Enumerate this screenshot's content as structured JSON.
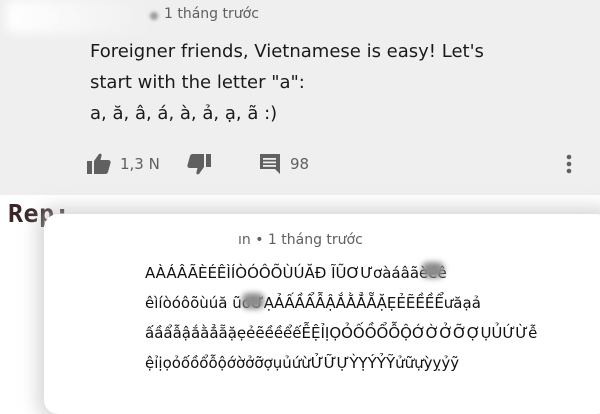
{
  "top_comment": {
    "timestamp": "1 tháng trước",
    "lines": [
      "Foreigner friends, Vietnamese is easy! Let's",
      "start with the letter \"a\":",
      "a, ă, â, á, à, ả, ạ, ã :)"
    ],
    "likes": "1,3 N",
    "reply_count": "98"
  },
  "rep_label": "Rep:",
  "reply": {
    "timestamp": "ın • 1 tháng trước",
    "lines": [
      "AÀÁÂÃÈÉÊÌÍÒÓÔÕÙÚĂĐ  ĨŨƠƯơàáâãèéê",
      "êìíòóôõùúă  ũơƯẠẢẤẦẨẪẬẮẰẲẴẶẸẺẼỀỀỂưăạả",
      "ấầẩẫậắằẳẵặẹẻẽềềểếỄỆỈỊỌỎỐỒỔỖỘỚỜỞỠỢỤỦỨỪễ",
      "ệỉịọỏốồổỗộớờởỡợụủứừỬỮỰỲỴÝỶỸửữựỳỵỷỹ"
    ]
  },
  "icons": {
    "like": "thumbs-up-icon",
    "dislike": "thumbs-down-icon",
    "reply": "comment-icon",
    "more": "more-vertical-icon"
  },
  "colors": {
    "top_bg": "#efefef",
    "text": "#1a1a1a",
    "meta": "#606060",
    "rep_label": "#3a2626"
  }
}
